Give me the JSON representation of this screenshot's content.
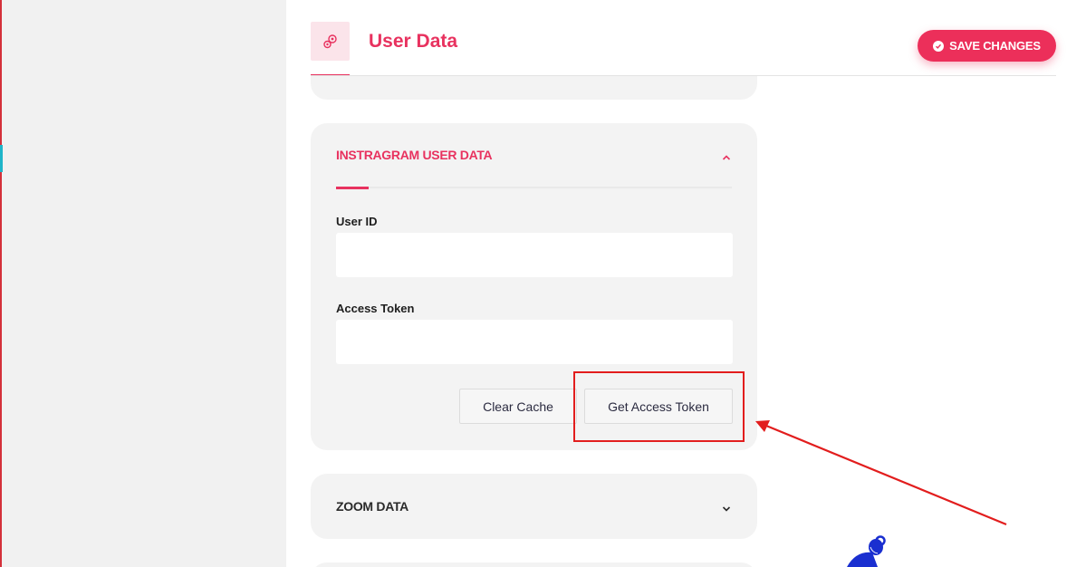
{
  "header": {
    "title": "User Data",
    "save_label": "SAVE CHANGES"
  },
  "instagram_section": {
    "title": "INSTRAGRAM USER DATA",
    "user_id_label": "User ID",
    "user_id_value": "",
    "access_token_label": "Access Token",
    "access_token_value": "",
    "clear_cache_label": "Clear Cache",
    "get_token_label": "Get Access Token"
  },
  "zoom_section": {
    "title": "ZOOM DATA"
  },
  "icons": {
    "header": "gears-icon",
    "save": "check-circle-icon",
    "collapse": "chevron-up-icon",
    "expand": "chevron-down-icon"
  },
  "colors": {
    "accent": "#e8325f",
    "annotation": "#e21d1d",
    "card_bg": "#f3f3f3",
    "sidebar_bg": "#f1f1f1"
  }
}
